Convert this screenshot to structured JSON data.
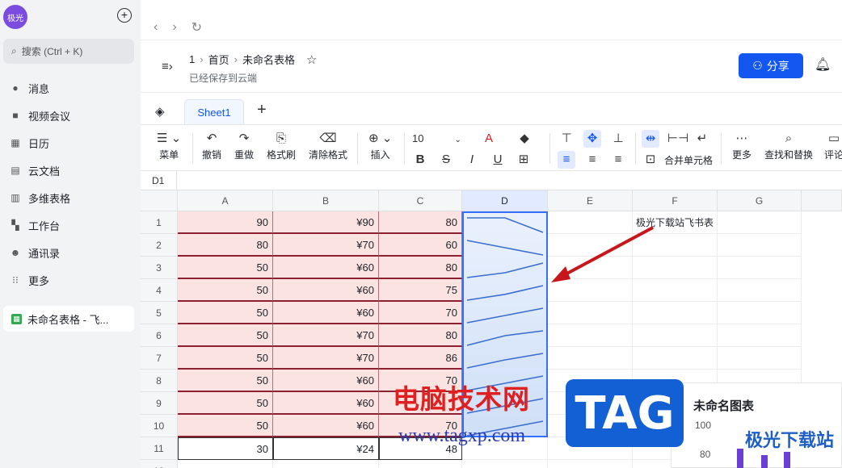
{
  "sidebar": {
    "logo": "极光",
    "search": "搜索 (Ctrl + K)",
    "items": [
      "消息",
      "视频会议",
      "日历",
      "云文档",
      "多维表格",
      "工作台",
      "通讯录",
      "更多"
    ],
    "doc": "未命名表格 - 飞..."
  },
  "header": {
    "breadcrumb": [
      "1",
      "首页",
      "未命名表格"
    ],
    "saved": "已经保存到云端",
    "share": "分享"
  },
  "tabs": {
    "sheet": "Sheet1"
  },
  "toolbar": {
    "menu": "菜单",
    "undo": "撤销",
    "redo": "重做",
    "format_painter": "格式刷",
    "clear": "清除格式",
    "insert": "插入",
    "font_size": "10",
    "merge": "合并单元格",
    "more": "更多",
    "find": "查找和替换",
    "comment": "评论"
  },
  "formula": {
    "cell": "D1"
  },
  "grid": {
    "columns": [
      "A",
      "B",
      "C",
      "D",
      "E",
      "F",
      "G"
    ],
    "rows": [
      "1",
      "2",
      "3",
      "4",
      "5",
      "6",
      "7",
      "8",
      "9",
      "10",
      "11",
      "12"
    ],
    "colA": [
      "90",
      "80",
      "50",
      "50",
      "50",
      "50",
      "50",
      "50",
      "50",
      "50",
      "30"
    ],
    "colB": [
      "¥90",
      "¥70",
      "¥60",
      "¥60",
      "¥60",
      "¥70",
      "¥70",
      "¥60",
      "¥60",
      "¥60",
      "¥24"
    ],
    "colC": [
      "80",
      "60",
      "80",
      "75",
      "70",
      "80",
      "86",
      "70",
      "",
      "70",
      "48"
    ],
    "f1": "极光下载站飞书表"
  },
  "chart": {
    "title": "未命名图表",
    "yticks": [
      "100",
      "80"
    ]
  },
  "watermark": {
    "line1": "电脑技术网",
    "line2": "www.tagxp.com",
    "tag": "TAG",
    "site": "极光下载站"
  }
}
